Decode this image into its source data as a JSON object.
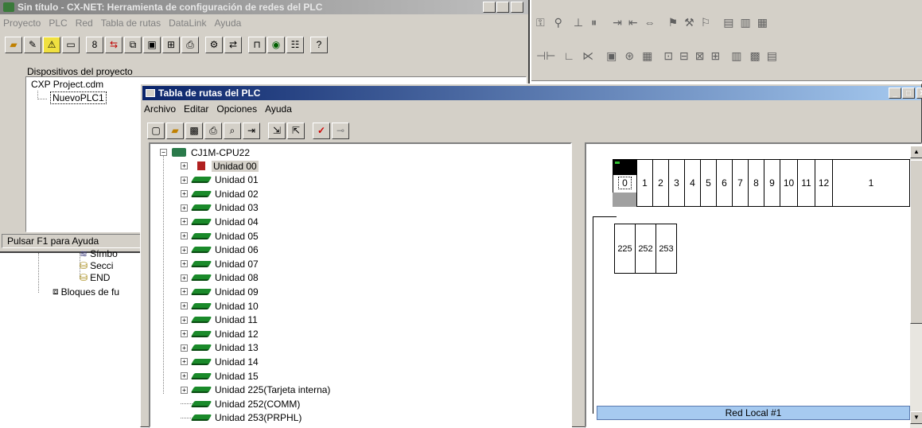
{
  "main_window": {
    "title": "Sin título - CX-NET: Herramienta de configuración de redes del PLC",
    "menu": [
      "Proyecto",
      "PLC",
      "Red",
      "Tabla de rutas",
      "DataLink",
      "Ayuda"
    ],
    "status": "Pulsar F1 para Ayuda",
    "project_panel_title": "Dispositivos del proyecto",
    "project_file": "CXP Project.cdm",
    "project_plc": "NuevoPLC1"
  },
  "background_tree": {
    "items": [
      "Símbo",
      "Secci",
      "END",
      "Bloques de fu"
    ]
  },
  "route_window": {
    "title": "Tabla de rutas del PLC",
    "menu": [
      "Archivo",
      "Editar",
      "Opciones",
      "Ayuda"
    ],
    "root": "CJ1M-CPU22",
    "units": [
      "Unidad 00",
      "Unidad 01",
      "Unidad 02",
      "Unidad 03",
      "Unidad 04",
      "Unidad 05",
      "Unidad 06",
      "Unidad 07",
      "Unidad 08",
      "Unidad 09",
      "Unidad 10",
      "Unidad 11",
      "Unidad 12",
      "Unidad 13",
      "Unidad 14",
      "Unidad 15",
      "Unidad 225(Tarjeta interna)",
      "Unidad 252(COMM)",
      "Unidad 253(PRPHL)"
    ],
    "rack_slots": [
      "0",
      "1",
      "2",
      "3",
      "4",
      "5",
      "6",
      "7",
      "8",
      "9",
      "10",
      "11",
      "12",
      "1"
    ],
    "sub_slots": [
      "225",
      "252",
      "253"
    ],
    "network_label": "Red Local #1"
  },
  "colors": {
    "titlebar": "#0a246a",
    "titlebar_inactive": "#808080",
    "face": "#d4d0c8",
    "network_bar": "#a6caf0"
  }
}
